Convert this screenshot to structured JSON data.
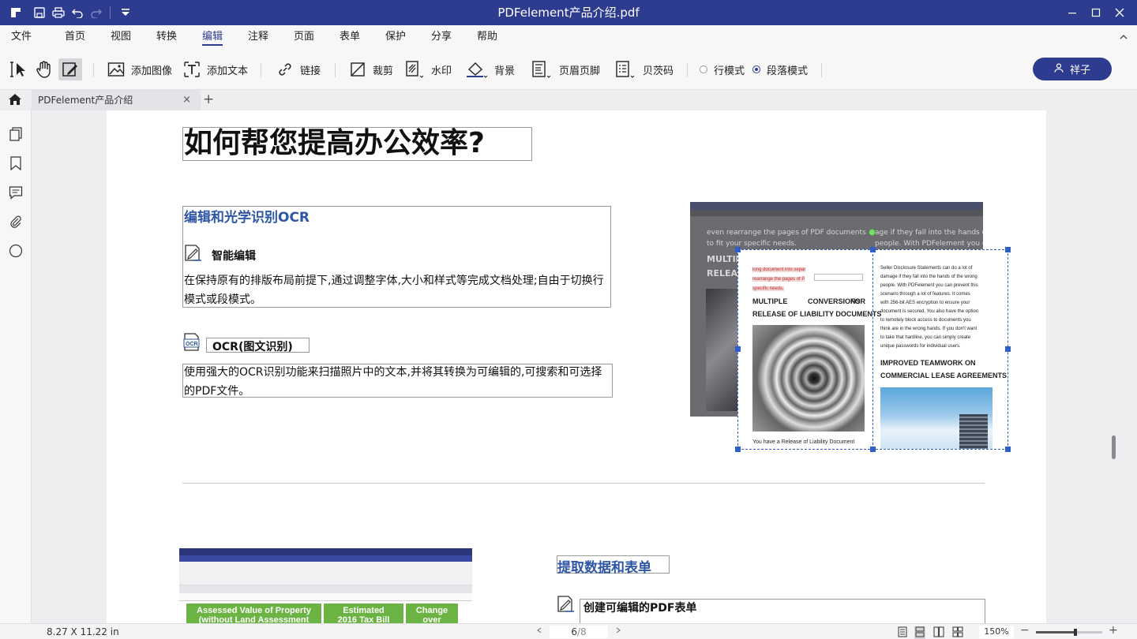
{
  "window": {
    "title": "PDFelement产品介绍.pdf",
    "colors": {
      "accent": "#2e3c8f",
      "heading_blue": "#2e56a6",
      "selection": "#2f5fc8"
    }
  },
  "menu": {
    "items": [
      "文件",
      "首页",
      "视图",
      "转换",
      "编辑",
      "注释",
      "页面",
      "表单",
      "保护",
      "分享",
      "帮助"
    ],
    "active": "编辑"
  },
  "ribbon": {
    "add_image": "添加图像",
    "add_text": "添加文本",
    "link": "链接",
    "crop": "裁剪",
    "watermark": "水印",
    "background": "背景",
    "header_footer": "页眉页脚",
    "bates": "贝茨码",
    "line_mode": "行模式",
    "paragraph_mode": "段落模式",
    "mode_selected": "段落模式",
    "user_name": "祥子"
  },
  "tabs": {
    "doc_tab": "PDFelement产品介绍",
    "close": "×",
    "new_tab": "+"
  },
  "page": {
    "main_heading": "如何帮您提高办公效率?",
    "section1": {
      "title": "编辑和光学识别OCR",
      "feature1_title": "智能编辑",
      "feature1_body": "在保持原有的排版布局前提下,通过调整字体,大小和样式等完成文档处理;自由于切换行模式或段模式。",
      "feature2_title": "OCR(图文识别)",
      "feature2_body": "使用强大的OCR识别功能来扫描照片中的文本,并将其转换为可编辑的,可搜索和可选择的PDF文件。"
    },
    "img1": {
      "line1": "even rearrange the pages of PDF documents",
      "line2": "to fit your specific needs.",
      "line3": "MULTIP",
      "line4": "RELEAS",
      "right1": "age if they fall into the hands of the",
      "right2": "people. With PDFelement you can preve"
    },
    "img2": {
      "hl1": "long document into separ",
      "hl2": "rearrange the pages of P",
      "hl3": "specific needs.",
      "col1_h1": "MULTIPLE",
      "col1_h1b": "CONVERSIONS",
      "col1_h1c": "FOR",
      "col1_h2": "RELEASE OF LIABILITY DOCUMENTS",
      "col1_foot": "You have a Release of Liability Document",
      "col2_p": [
        "Seller Disclosure Statements can do a lot of",
        "damage if they fall into the hands of the wrong",
        "people. With PDFelement you can prevent this",
        "scenario through a lot of features. It comes",
        "with 256-bit AES encryption to ensure your",
        "document is secured. You also have the option",
        "to remotely block access to documents you",
        "think are in the wrong hands. If you don't want",
        "to take that hardline, you can simply create",
        "unique passwords for individual users."
      ],
      "col2_h1": "IMPROVED TEAMWORK ON",
      "col2_h2": "COMMERCIAL LEASE AGREEMENTS"
    },
    "section2": {
      "title": "提取数据和表单",
      "feature1_title": "创建可编辑的PDF表单"
    },
    "img3": {
      "col1": "Assessed Value of Property",
      "col1b": "(without Land Assessment",
      "col2": "Estimated",
      "col2b": "2016 Tax Bill",
      "col3": "Change",
      "col3b": "over"
    }
  },
  "status": {
    "page_size": "8.27 X 11.22 in",
    "current_page": "6",
    "total_pages": "/8",
    "zoom": "150%",
    "zoom_level_fraction": 0.6
  }
}
